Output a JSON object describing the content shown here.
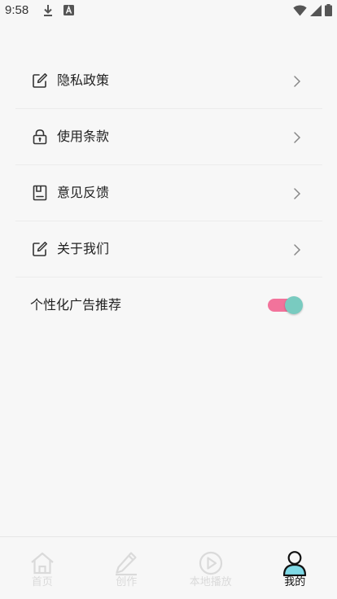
{
  "status_bar": {
    "time": "9:58"
  },
  "menu": {
    "items": [
      {
        "label": "隐私政策",
        "icon": "edit-icon"
      },
      {
        "label": "使用条款",
        "icon": "lock-icon"
      },
      {
        "label": "意见反馈",
        "icon": "feedback-icon"
      },
      {
        "label": "关于我们",
        "icon": "edit-icon"
      }
    ],
    "toggle_row": {
      "label": "个性化广告推荐",
      "enabled": true
    }
  },
  "bottom_nav": {
    "items": [
      {
        "label": "首页",
        "icon": "home-icon",
        "active": false
      },
      {
        "label": "创作",
        "icon": "pen-icon",
        "active": false
      },
      {
        "label": "本地播放",
        "icon": "play-icon",
        "active": false
      },
      {
        "label": "我的",
        "icon": "profile-icon",
        "active": true
      }
    ]
  },
  "colors": {
    "background": "#f7f7f7",
    "toggle_track": "#f2739b",
    "toggle_thumb": "#79cbc0",
    "inactive_nav": "#dadada",
    "active_nav": "#111111",
    "profile_accent": "#7fd9e6"
  }
}
